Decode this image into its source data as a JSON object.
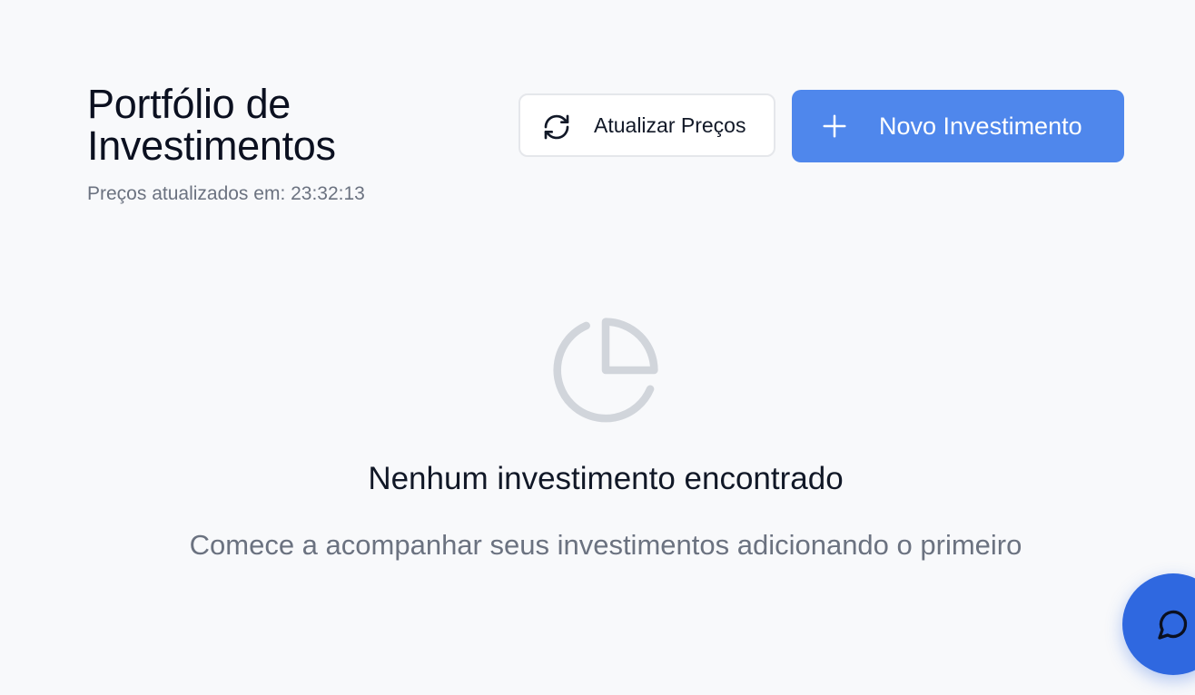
{
  "header": {
    "title": "Portfólio de Investimentos",
    "subtitle": "Preços atualizados em: 23:32:13"
  },
  "actions": {
    "refresh": {
      "label": "Atualizar Preços",
      "icon": "refresh-icon"
    },
    "new_investment": {
      "label": "Novo Investimento",
      "icon": "plus-icon"
    }
  },
  "empty_state": {
    "icon": "pie-chart-icon",
    "title": "Nenhum investimento encontrado",
    "description": "Comece a acompanhar seus investimentos adicionando o primeiro"
  },
  "chat": {
    "icon": "chat-bubble-icon"
  },
  "colors": {
    "background": "#f8f9fb",
    "primary": "#4f87ec",
    "chat_button": "#2f68e0",
    "muted_text": "#6b7280",
    "empty_icon": "#d1d5db"
  }
}
